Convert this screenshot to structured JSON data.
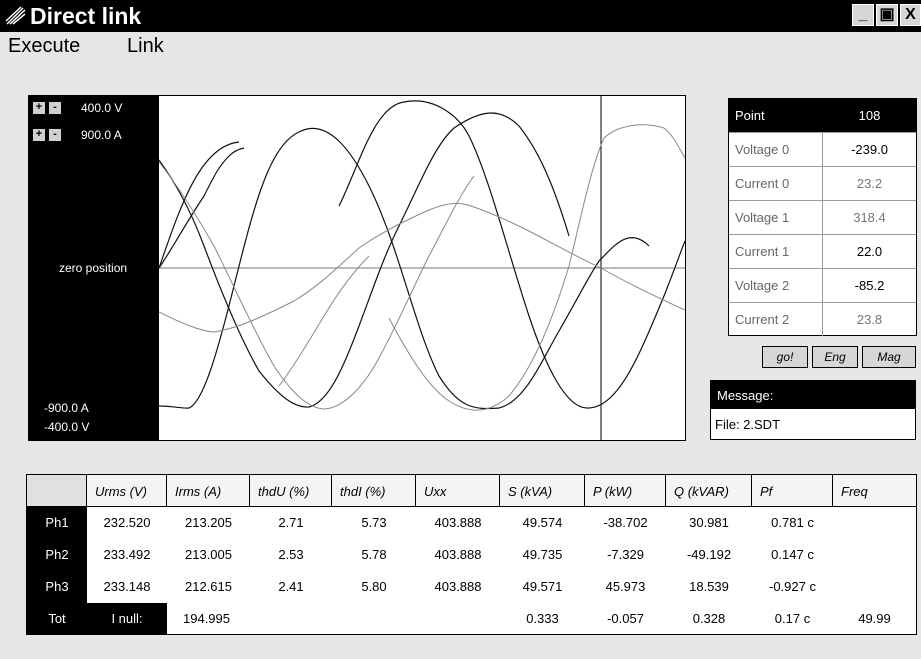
{
  "window": {
    "title": "Direct link",
    "logo_icon": "lightning-logo-icon"
  },
  "window_buttons": [
    "_",
    "▣",
    "X"
  ],
  "menu": {
    "execute": "Execute",
    "link": "Link"
  },
  "scope": {
    "voltage_scale": "400.0 V",
    "current_scale": "900.0 A",
    "zero_label": "zero position",
    "bottom_current": "-900.0 A",
    "bottom_voltage": "-400.0 V",
    "plus": "+",
    "minus": "-"
  },
  "point_table": {
    "header": {
      "label": "Point",
      "value": "108"
    },
    "rows": [
      {
        "label": "Voltage 0",
        "value": "-239.0"
      },
      {
        "label": "Current 0",
        "value": "23.2"
      },
      {
        "label": "Voltage 1",
        "value": "318.4"
      },
      {
        "label": "Current 1",
        "value": "22.0"
      },
      {
        "label": "Voltage 2",
        "value": "-85.2"
      },
      {
        "label": "Current 2",
        "value": "23.8"
      }
    ]
  },
  "buttons": {
    "go": "go!",
    "eng": "Eng",
    "mag": "Mag"
  },
  "message": {
    "header": "Message:",
    "text": "File: 2.SDT"
  },
  "measurements": {
    "columns": [
      "Urms (V)",
      "Irms (A)",
      "thdU (%)",
      "thdI (%)",
      "Uxx",
      "S (kVA)",
      "P (kW)",
      "Q (kVAR)",
      "Pf",
      "Freq"
    ],
    "rows": [
      {
        "label": "Ph1",
        "cells": [
          "232.520",
          "213.205",
          "2.71",
          "5.73",
          "403.888",
          "49.574",
          "-38.702",
          "30.981",
          "0.781  c",
          ""
        ]
      },
      {
        "label": "Ph2",
        "cells": [
          "233.492",
          "213.005",
          "2.53",
          "5.78",
          "403.888",
          "49.735",
          "-7.329",
          "-49.192",
          "0.147  c",
          ""
        ]
      },
      {
        "label": "Ph3",
        "cells": [
          "233.148",
          "212.615",
          "2.41",
          "5.80",
          "403.888",
          "49.571",
          "45.973",
          "18.539",
          "-0.927  c",
          ""
        ]
      },
      {
        "label": "Tot",
        "null_label": "I null:",
        "cells": [
          "",
          "194.995",
          "",
          "",
          "",
          "0.333",
          "-0.057",
          "0.328",
          "0.17  c",
          "49.99"
        ]
      }
    ]
  }
}
